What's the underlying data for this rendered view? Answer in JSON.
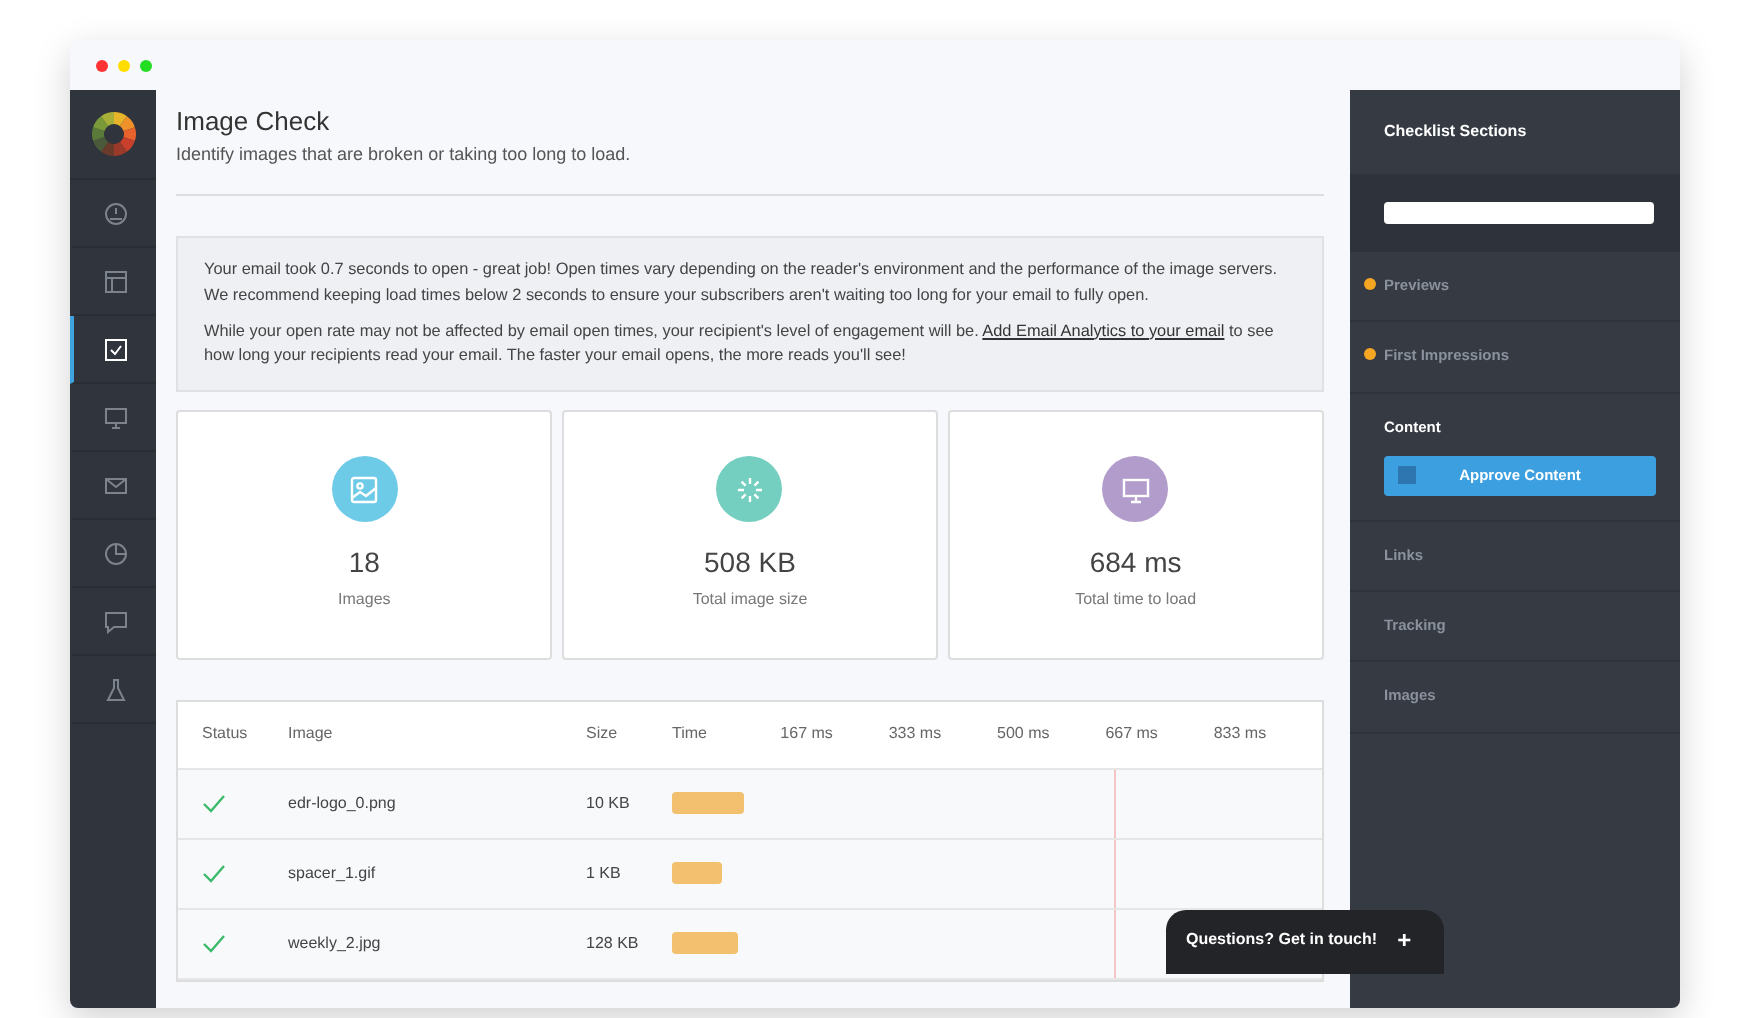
{
  "sidebar": {
    "items": [
      {
        "selected": false
      },
      {
        "selected": false
      },
      {
        "selected": true
      },
      {
        "selected": false
      },
      {
        "selected": false
      },
      {
        "selected": false
      },
      {
        "selected": false
      },
      {
        "selected": false
      }
    ]
  },
  "header": {
    "title": "Image Check",
    "subtitle": "Identify images that are broken or taking too long to load."
  },
  "notice": {
    "paragraphs": [
      "Your email took 0.7 seconds to open - great job! Open times vary depending on the reader's environment and the performance of the image servers. We recommend keeping load times below 2 seconds to ensure your subscribers aren't waiting too long for your email to fully open."
    ],
    "last_paragraph": {
      "before": "While your open rate may not be affected by email open times, your recipient's level of engagement will be. ",
      "link": "Add Email Analytics to your email",
      "after": " to see how long your recipients read your email. The faster your email opens, the more reads you'll see!"
    }
  },
  "stats": [
    {
      "color": "#6ecbe8",
      "value": "18",
      "label": "Images"
    },
    {
      "color": "#74cfc0",
      "value": "508 KB",
      "label": "Total image size"
    },
    {
      "color": "#b29ccb",
      "value": "684 ms",
      "label": "Total time to load"
    }
  ],
  "table": {
    "columns": [
      "Status",
      "Image",
      "Size",
      "Time"
    ],
    "ticks": [
      "167 ms",
      "333 ms",
      "500 ms",
      "667 ms",
      "833 ms"
    ],
    "total_marker": {
      "level": 0.684
    },
    "rows": [
      {
        "ok": true,
        "image": "edr-logo_0.png",
        "size": "10 KB",
        "level": 0.11
      },
      {
        "ok": true,
        "image": "spacer_1.gif",
        "size": "1 KB",
        "level": 0.078
      },
      {
        "ok": true,
        "image": "weekly_2.jpg",
        "size": "128 KB",
        "level": 0.1
      }
    ]
  },
  "checklist": {
    "title": "Checklist Sections",
    "items": [
      {
        "label": "Previews",
        "dot": true,
        "selected": false
      },
      {
        "label": "First Impressions",
        "dot": true,
        "selected": false
      },
      {
        "label": "Content",
        "dot": false,
        "selected": true,
        "action": {
          "label": "Approve Content",
          "checked": false
        }
      },
      {
        "label": "Links",
        "dot": false,
        "selected": false
      },
      {
        "label": "Tracking",
        "dot": false,
        "selected": false
      },
      {
        "label": "Images",
        "dot": false,
        "selected": false
      }
    ]
  },
  "chat": {
    "label": "Questions? Get in touch!",
    "icon": "+"
  }
}
